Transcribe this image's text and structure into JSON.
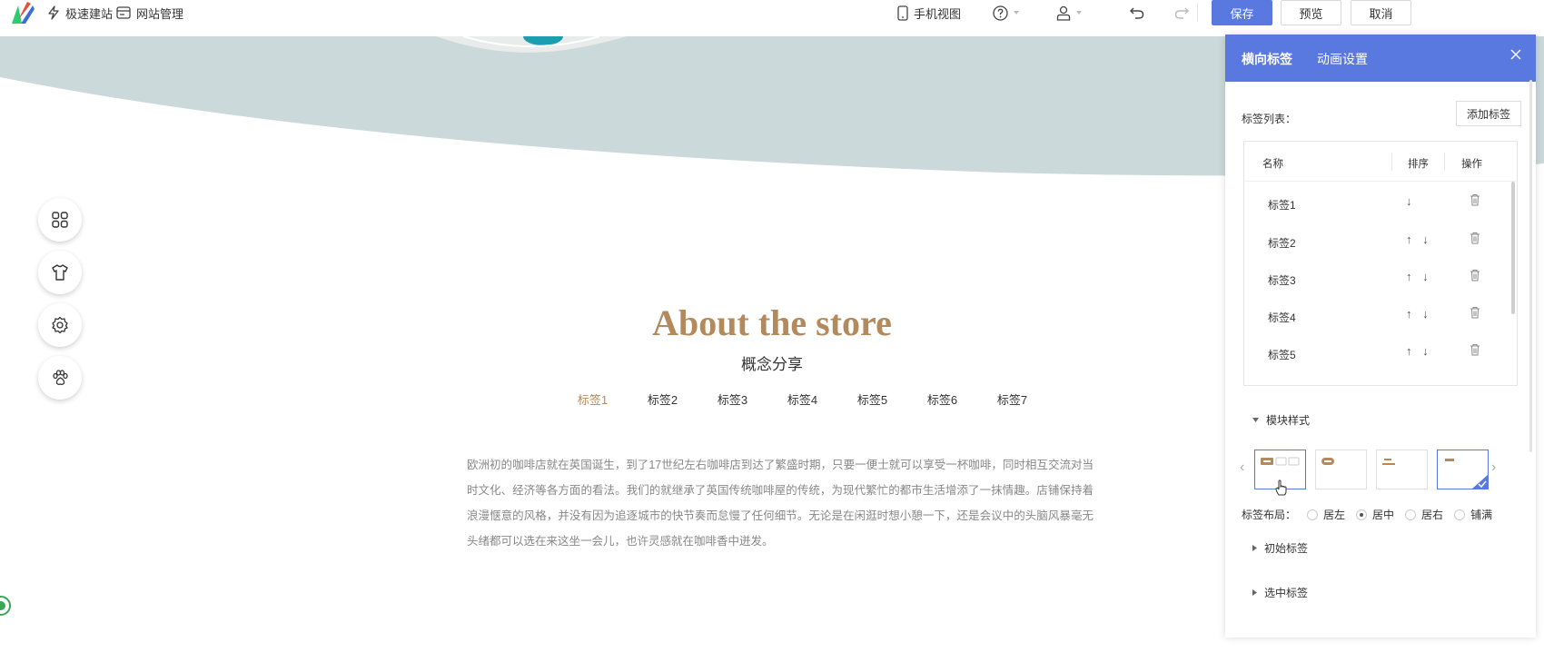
{
  "topbar": {
    "quick_build": "极速建站",
    "site_manage": "网站管理",
    "mobile_view": "手机视图",
    "save": "保存",
    "preview": "预览",
    "cancel": "取消"
  },
  "toolrail": {
    "icons": [
      "grid-icon",
      "shirt-icon",
      "settings-icon",
      "paw-icon"
    ]
  },
  "content": {
    "title": "About the store",
    "subtitle": "概念分享",
    "tabs": [
      "标签1",
      "标签2",
      "标签3",
      "标签4",
      "标签5",
      "标签6",
      "标签7"
    ],
    "active_tab": 0,
    "paragraph": "欧洲初的咖啡店就在英国诞生，到了17世纪左右咖啡店到达了繁盛时期，只要一便士就可以享受一杯咖啡，同时相互交流对当时文化、经济等各方面的看法。我们的就继承了英国传统咖啡屋的传统，为现代繁忙的都市生活增添了一抹情趣。店铺保持着浪漫惬意的风格，并没有因为追逐城市的快节奏而怠慢了任何细节。无论是在闲逛时想小憩一下，还是会议中的头脑风暴毫无头绪都可以选在来这坐一会儿，也许灵感就在咖啡香中迸发。"
  },
  "panel": {
    "tab_horizontal": "横向标签",
    "tab_animation": "动画设置",
    "label_list_title": "标签列表：",
    "add_label": "添加标签",
    "col_name": "名称",
    "col_sort": "排序",
    "col_op": "操作",
    "rows": [
      {
        "name": "标签1",
        "sort": "↓"
      },
      {
        "name": "标签2",
        "sort": "↑ ↓"
      },
      {
        "name": "标签3",
        "sort": "↑ ↓"
      },
      {
        "name": "标签4",
        "sort": "↑ ↓"
      },
      {
        "name": "标签5",
        "sort": "↑ ↓"
      }
    ],
    "module_style": "模块样式",
    "layout_label": "标签布局：",
    "layout_options": [
      "居左",
      "居中",
      "居右",
      "铺满"
    ],
    "layout_selected": 1,
    "initial_label": "初始标签",
    "selected_label": "选中标签",
    "accent_color": "#5a79e0",
    "brand_color": "#b38a5c"
  }
}
